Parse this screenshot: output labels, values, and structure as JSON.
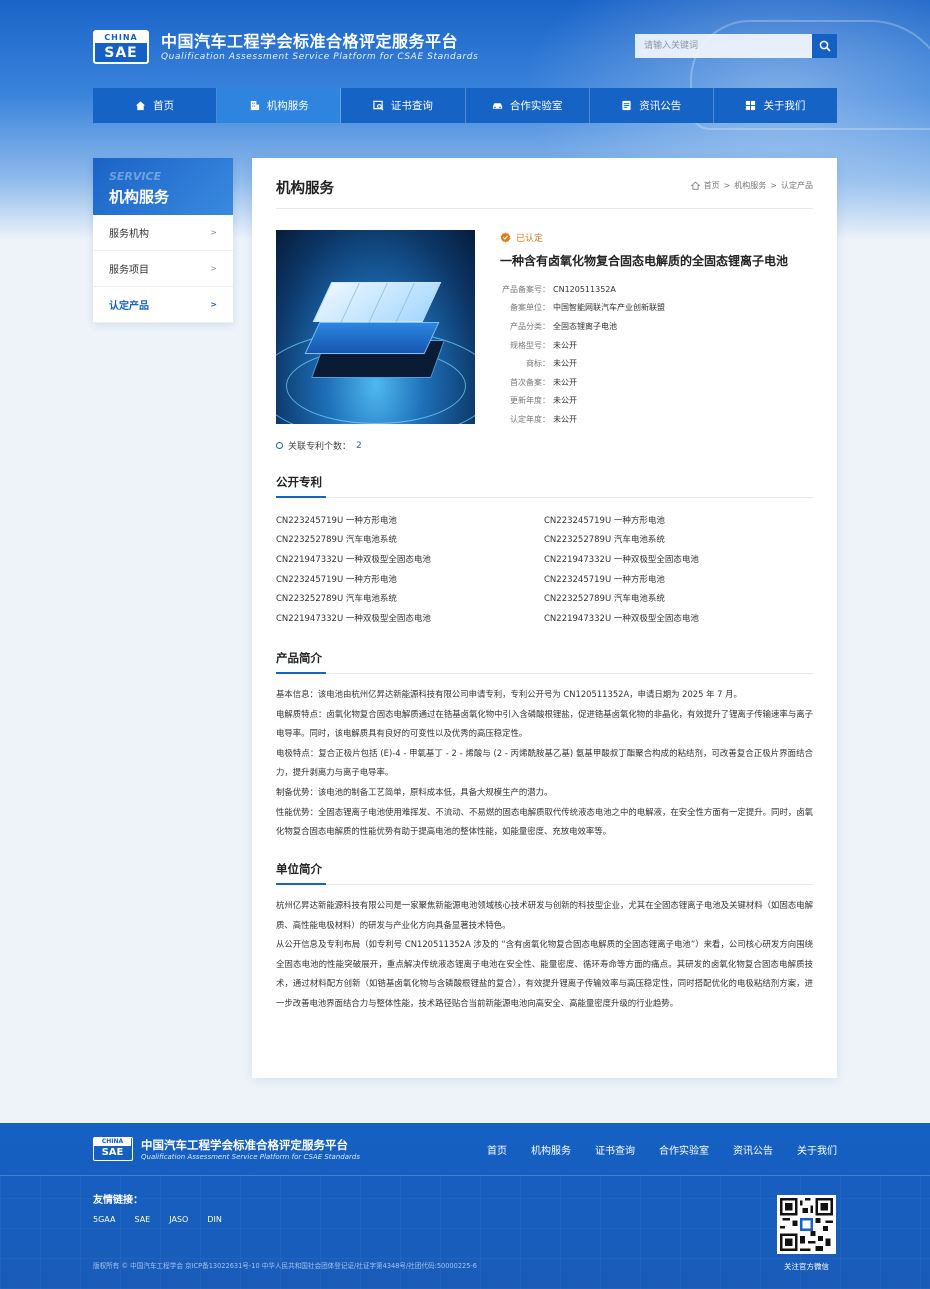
{
  "header": {
    "logo_top": "CHINA",
    "logo_bottom": "SAE",
    "title": "中国汽车工程学会标准合格评定服务平台",
    "subtitle": "Qualification Assessment Service Platform for CSAE Standards",
    "search_placeholder": "请输入关键词"
  },
  "nav": [
    {
      "label": "首页",
      "icon": "home-icon"
    },
    {
      "label": "机构服务",
      "icon": "building-icon",
      "active": true
    },
    {
      "label": "证书查询",
      "icon": "certificate-search-icon"
    },
    {
      "label": "合作实验室",
      "icon": "car-icon"
    },
    {
      "label": "资讯公告",
      "icon": "news-icon"
    },
    {
      "label": "关于我们",
      "icon": "grid-icon"
    }
  ],
  "sidebar": {
    "title_en": "SERVICE",
    "title": "机构服务",
    "items": [
      {
        "label": "服务机构",
        "arrow": ">"
      },
      {
        "label": "服务项目",
        "arrow": ">"
      },
      {
        "label": "认定产品",
        "arrow": ">",
        "active": true
      }
    ]
  },
  "main": {
    "title": "机构服务",
    "breadcrumb": [
      "首页",
      ">",
      "机构服务",
      ">",
      "认定产品"
    ],
    "product": {
      "status": "已认定",
      "name": "一种含有卤氧化物复合固态电解质的全固态锂离子电池",
      "fields": [
        {
          "k": "产品备案号：",
          "v": "CN120511352A"
        },
        {
          "k": "备案单位：",
          "v": "中国智能网联汽车产业创新联盟"
        },
        {
          "k": "产品分类：",
          "v": "全固态锂离子电池"
        },
        {
          "k": "规格型号：",
          "v": "未公开"
        },
        {
          "k": "商标：",
          "v": "未公开"
        },
        {
          "k": "首次备案：",
          "v": "未公开"
        },
        {
          "k": "更新年度：",
          "v": "未公开"
        },
        {
          "k": "认定年度：",
          "v": "未公开"
        }
      ],
      "related_label": "关联专利个数：",
      "related_count": "2"
    },
    "patents_title": "公开专利",
    "patents": [
      "CN223245719U 一种方形电池",
      "CN223245719U 一种方形电池",
      "CN223252789U 汽车电池系统",
      "CN223252789U 汽车电池系统",
      "CN221947332U 一种双极型全固态电池",
      "CN221947332U 一种双极型全固态电池",
      "CN223245719U 一种方形电池",
      "CN223245719U 一种方形电池",
      "CN223252789U 汽车电池系统",
      "CN223252789U 汽车电池系统",
      "CN221947332U 一种双极型全固态电池",
      "CN221947332U 一种双极型全固态电池"
    ],
    "intro_title": "产品简介",
    "intro": [
      "基本信息：该电池由杭州亿昇达新能源科技有限公司申请专利，专利公开号为 CN120511352A，申请日期为 2025 年 7 月。",
      "电解质特点：卤氧化物复合固态电解质通过在锆基卤氧化物中引入含磷酸根锂盐，促进锆基卤氧化物的非晶化，有效提升了锂离子传输速率与离子电导率。同时，该电解质具有良好的可变性以及优秀的高压稳定性。",
      "电极特点：复合正极片包括 (E)-4 - 甲氧基丁 - 2 - 烯酸与 (2 - 丙烯酰胺基乙基) 氨基甲酸叔丁酯聚合构成的粘结剂，可改善复合正极片界面结合力，提升剥离力与离子电导率。",
      "制备优势：该电池的制备工艺简单，原料成本低，具备大规模生产的潜力。",
      "性能优势：全固态锂离子电池使用难挥发、不流动、不易燃的固态电解质取代传统液态电池之中的电解液，在安全性方面有一定提升。同时，卤氧化物复合固态电解质的性能优势有助于提高电池的整体性能，如能量密度、充放电效率等。"
    ],
    "company_title": "单位简介",
    "company": [
      "杭州亿昇达新能源科技有限公司是一家聚焦新能源电池领域核心技术研发与创新的科技型企业，尤其在全固态锂离子电池及关键材料（如固态电解质、高性能电极材料）的研发与产业化方向具备显著技术特色。",
      "从公开信息及专利布局（如专利号 CN120511352A 涉及的 “含有卤氧化物复合固态电解质的全固态锂离子电池”）来看，公司核心研发方向围绕全固态电池的性能突破展开，重点解决传统液态锂离子电池在安全性、能量密度、循环寿命等方面的痛点。其研发的卤氧化物复合固态电解质技术，通过材料配方创新（如锆基卤氧化物与含磷酸根锂盐的复合），有效提升锂离子传输效率与高压稳定性，同时搭配优化的电极粘结剂方案，进一步改善电池界面结合力与整体性能，技术路径贴合当前新能源电池向高安全、高能量密度升级的行业趋势。"
    ]
  },
  "footer": {
    "logo_top": "CHINA",
    "logo_bottom": "SAE",
    "title": "中国汽车工程学会标准合格评定服务平台",
    "subtitle": "Qualification Assessment Service Platform for CSAE Standards",
    "nav": [
      "首页",
      "机构服务",
      "证书查询",
      "合作实验室",
      "资讯公告",
      "关于我们"
    ],
    "links_title": "友情链接：",
    "links": [
      "5GAA",
      "SAE",
      "JASO",
      "DIN"
    ],
    "qr_label": "关注官方微信",
    "copyright": "版权所有 © 中国汽车工程学会 京ICP备13022631号-10 中华人民共和国社会团体登记证/社证字第4348号/社团代码:50000225-6"
  },
  "colors": {
    "primary": "#1663c6",
    "accent_active": "#2f84e0",
    "certified": "#e07b1a"
  }
}
